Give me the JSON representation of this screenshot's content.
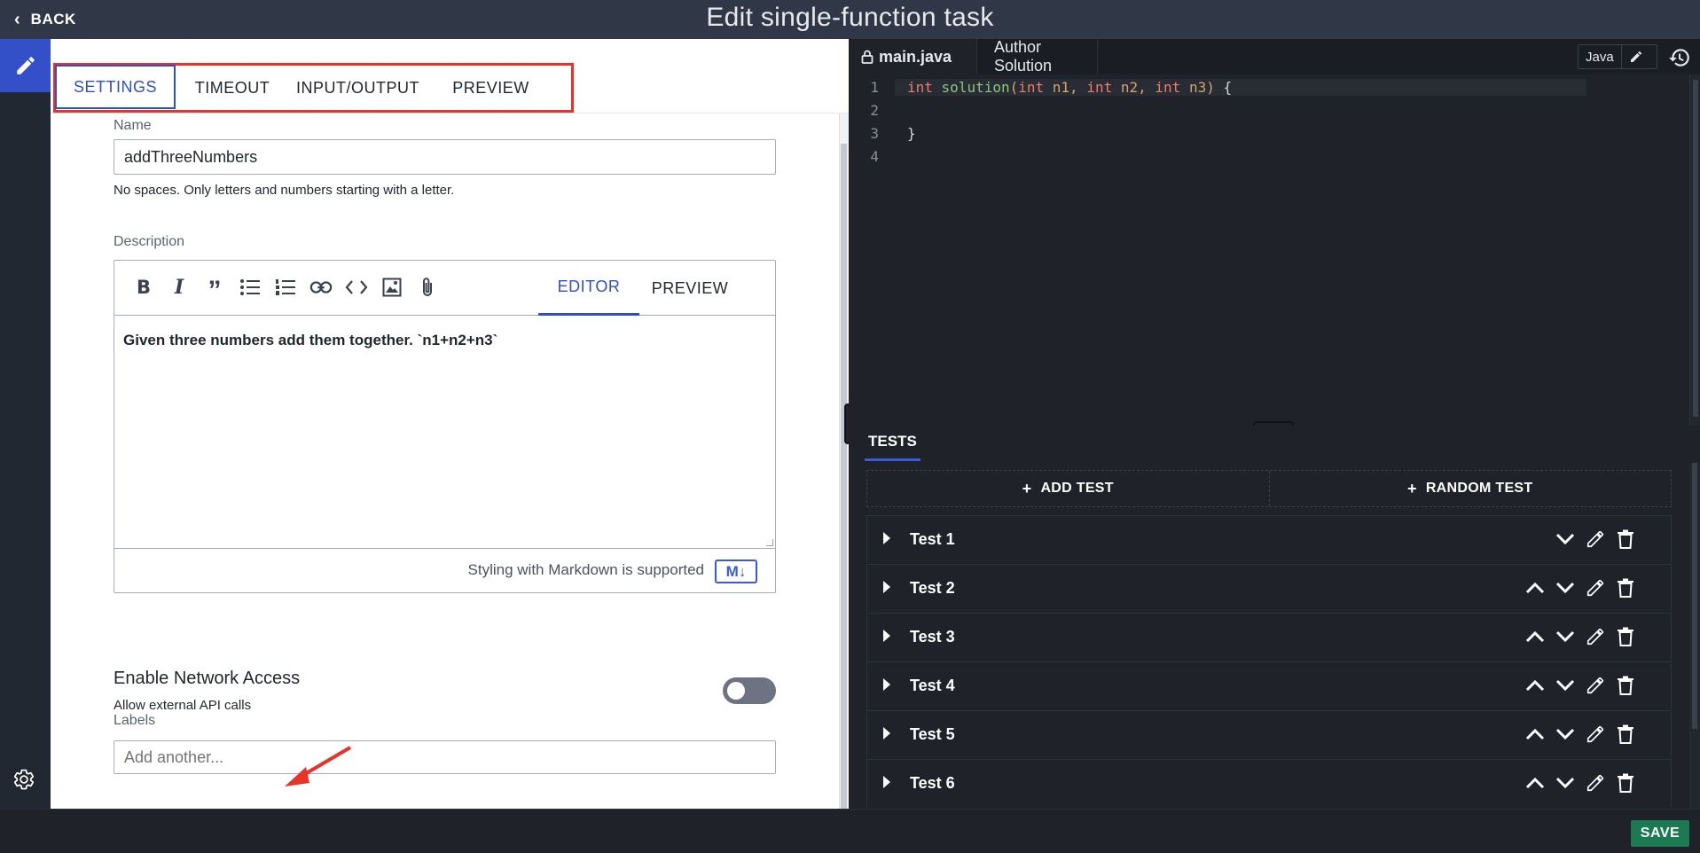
{
  "header": {
    "back_label": "BACK",
    "title": "Edit single-function task"
  },
  "settings": {
    "tabs": [
      "SETTINGS",
      "TIMEOUT",
      "INPUT/OUTPUT",
      "PREVIEW"
    ],
    "name_label": "Name",
    "name_value": "addThreeNumbers",
    "name_hint": "No spaces. Only letters and numbers starting with a letter.",
    "description_label": "Description",
    "editor_tabs": [
      "EDITOR",
      "PREVIEW"
    ],
    "description_text": "Given three numbers add them together. `n1+n2+n3`",
    "markdown_hint": "Styling with Markdown is supported",
    "markdown_badge": "M↓",
    "network_title": "Enable Network Access",
    "network_subtitle": "Allow external API calls",
    "network_enabled": false,
    "labels_label": "Labels",
    "labels_placeholder": "Add another..."
  },
  "editor": {
    "file_tab": "main.java",
    "author_tab": "Author Solution",
    "language": "Java",
    "line_numbers": [
      "1",
      "2",
      "3",
      "4"
    ],
    "code": {
      "int1": "int",
      "fn": "solution",
      "open": "(",
      "int2": "int",
      "p1": " n1, ",
      "int3": "int",
      "p2": " n2, ",
      "int4": "int",
      "p3": " n3",
      "close": ")",
      "brace_open": " {",
      "brace_close": "}"
    }
  },
  "tests": {
    "tab_label": "TESTS",
    "add_test": "ADD TEST",
    "random_test": "RANDOM TEST",
    "items": [
      "Test 1",
      "Test 2",
      "Test 3",
      "Test 4",
      "Test 5",
      "Test 6"
    ]
  },
  "footer": {
    "save_label": "SAVE"
  },
  "colors": {
    "accent": "#2f4fc6",
    "highlight_box": "#e8332a",
    "save": "#1b7a52"
  }
}
